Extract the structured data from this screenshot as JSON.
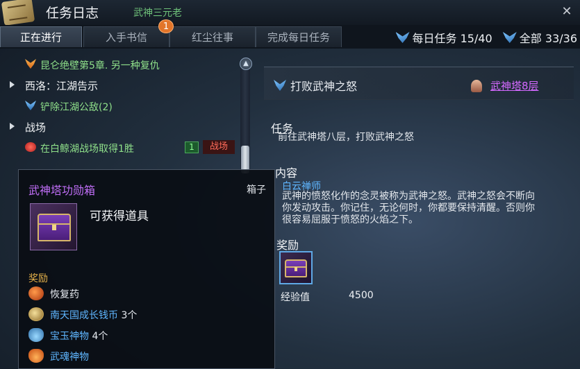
{
  "window": {
    "title": "任务日志",
    "background_npc_name": "武神三元老",
    "close_icon": "close-icon"
  },
  "tabs": [
    {
      "label": "正在进行",
      "active": true
    },
    {
      "label": "入手书信",
      "active": false,
      "badge": "1"
    },
    {
      "label": "红尘往事",
      "active": false
    },
    {
      "label": "完成每日任务",
      "active": false
    }
  ],
  "counters": {
    "daily": "每日任务 15/40",
    "all": "全部 33/36"
  },
  "quest_list": [
    {
      "type": "quest",
      "icon": "orange-wing-icon",
      "text": "昆仑绝壁第5章. 另一种复仇",
      "color": "#8fe08a"
    },
    {
      "type": "category",
      "text": "西洛：江湖告示"
    },
    {
      "type": "quest",
      "icon": "blue-wing-icon",
      "text": "铲除江湖公敌(2)",
      "color": "#8fe08a"
    },
    {
      "type": "category",
      "text": "战场"
    },
    {
      "type": "quest",
      "icon": "red-mask-icon",
      "text": "在白鲸湖战场取得1胜",
      "color": "#8fe08a",
      "level": "1",
      "tag": "战场"
    }
  ],
  "tooltip": {
    "name": "武神塔功勋箱",
    "item_type": "箱子",
    "obtain_label": "可获得道具",
    "reward_label": "奖励",
    "items": [
      {
        "icon": "potion-icon",
        "name": "恢复药",
        "count": "",
        "name_color": "#eef1f4"
      },
      {
        "icon": "coin-icon",
        "name": "南天国成长钱币",
        "count": "3个",
        "name_color": "#5fb6ff"
      },
      {
        "icon": "jade-icon",
        "name": "宝玉神物",
        "count": "4个",
        "name_color": "#5fb6ff"
      },
      {
        "icon": "soul-icon",
        "name": "武魂神物",
        "count": "",
        "name_color": "#5fb6ff"
      }
    ]
  },
  "detail": {
    "title": "打败武神之怒",
    "location_link": "武神塔8层",
    "task_heading": "任务",
    "task_text": "前往武神塔八层，打败武神之怒",
    "content_heading": "内容",
    "npc_name": "白云禅师",
    "content_lines": [
      "武神的愤怒化作的念灵被称为武神之怒。武神之怒会不断向",
      "你发动攻击。你记住，无论何时，你都要保持清醒。否则你",
      "很容易屈服于愤怒的火焰之下。"
    ],
    "reward_heading": "奖励",
    "exp_label": "经验值",
    "exp_value": "4500"
  },
  "colors": {
    "quest_green": "#8fe08a",
    "tooltip_title": "#c06ef7",
    "link_purple": "#d469ff",
    "npc_blue": "#5fb6ff",
    "reward_orange": "#e6b24a"
  }
}
